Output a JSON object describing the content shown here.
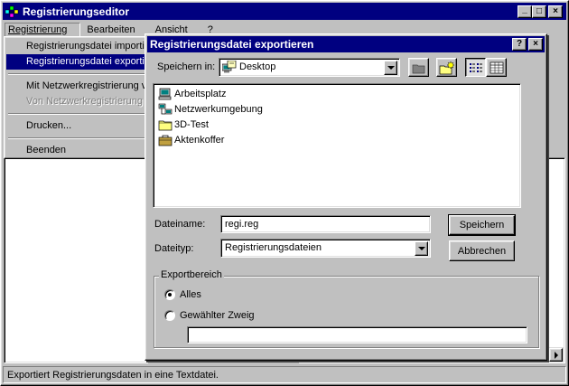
{
  "app": {
    "title": "Registrierungseditor",
    "window_buttons": [
      "_",
      "□",
      "×"
    ]
  },
  "menubar": {
    "items": [
      {
        "label": "Registrierung"
      },
      {
        "label": "Bearbeiten"
      },
      {
        "label": "Ansicht"
      },
      {
        "label": "?"
      }
    ]
  },
  "registry_menu": {
    "items": [
      {
        "label": "Registrierungsdatei importieren...",
        "state": "normal"
      },
      {
        "label": "Registrierungsdatei exportieren...",
        "state": "selected"
      },
      {
        "label": "Mit Netzwerkregistrierung verbinden...",
        "state": "normal"
      },
      {
        "label": "Von Netzwerkregistrierung trennen...",
        "state": "disabled"
      },
      {
        "label": "Drucken...",
        "state": "normal"
      },
      {
        "label": "Beenden",
        "state": "normal"
      }
    ]
  },
  "statusbar": {
    "text": "Exportiert Registrierungsdaten in eine Textdatei."
  },
  "dialog": {
    "title": "Registrierungsdatei exportieren",
    "help_button": "?",
    "close_button": "×",
    "save_in_label": "Speichern in:",
    "save_in_value": "Desktop",
    "files": [
      {
        "name": "Arbeitsplatz",
        "icon": "computer-icon"
      },
      {
        "name": "Netzwerkumgebung",
        "icon": "network-icon"
      },
      {
        "name": "3D-Test",
        "icon": "folder-icon"
      },
      {
        "name": "Aktenkoffer",
        "icon": "briefcase-icon"
      }
    ],
    "filename_label": "Dateiname:",
    "filename_value": "regi.reg",
    "filetype_label": "Dateityp:",
    "filetype_value": "Registrierungsdateien",
    "save_button": "Speichern",
    "cancel_button": "Abbrechen",
    "export_range": {
      "legend": "Exportbereich",
      "options": [
        {
          "label": "Alles",
          "selected": true
        },
        {
          "label": "Gewählter Zweig",
          "selected": false
        }
      ],
      "branch_value": ""
    }
  }
}
